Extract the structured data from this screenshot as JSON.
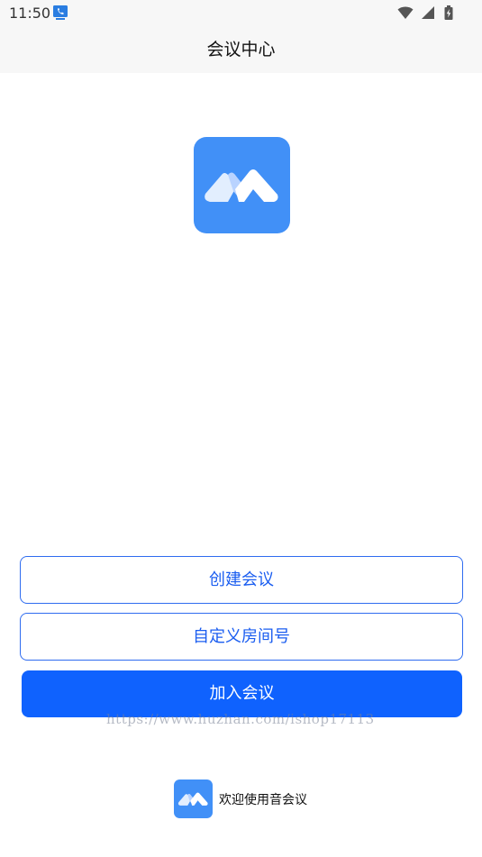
{
  "status_bar": {
    "time": "11:50",
    "app_icon": "support-phone-icon",
    "wifi_icon": "wifi-icon",
    "signal_icon": "signal-icon",
    "battery_icon": "battery-charging-icon"
  },
  "header": {
    "title": "会议中心"
  },
  "logo": {
    "icon": "meeting-logo-icon",
    "brand_color": "#4190f7"
  },
  "actions": {
    "create_label": "创建会议",
    "custom_room_label": "自定义房间号",
    "join_label": "加入会议"
  },
  "watermark": {
    "text": "https://www.huzhan.com/ishop17113"
  },
  "footer": {
    "icon": "meeting-logo-icon",
    "welcome_text": "欢迎使用音会议"
  },
  "colors": {
    "accent": "#0f62fe",
    "outline_text": "#1a5df0",
    "header_bg": "#f7f7f7"
  }
}
